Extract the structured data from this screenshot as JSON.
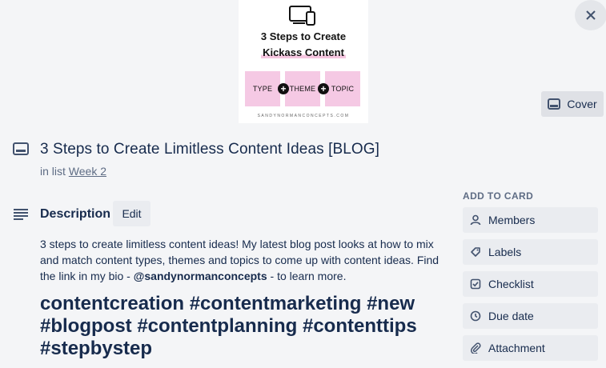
{
  "cover": {
    "title_line1": "3 Steps to Create",
    "title_line2": "Kickass Content",
    "tiles": [
      "TYPE",
      "THEME",
      "TOPIC"
    ],
    "plus": "+",
    "footer": "SANDYNORMANCONCEPTS.COM",
    "cover_button_label": "Cover",
    "close_icon": "close-icon"
  },
  "card": {
    "title": "3 Steps to Create Limitless Content Ideas [BLOG]",
    "in_list_prefix": "in list",
    "list_name": "Week 2"
  },
  "description": {
    "heading": "Description",
    "edit_label": "Edit",
    "text_before": "3 steps to create limitless content ideas! My latest blog post looks at how to mix and match content types, themes and topics to come up with content ideas. Find the link in my bio - ",
    "mention": "@sandynormanconcepts",
    "text_after": " - to learn more.",
    "hashtags": "contentcreation #contentmarketing #new #blogpost #contentplanning #contenttips #stepbystep"
  },
  "sidebar": {
    "heading": "ADD TO CARD",
    "items": [
      {
        "label": "Members",
        "icon": "person-icon"
      },
      {
        "label": "Labels",
        "icon": "tag-icon"
      },
      {
        "label": "Checklist",
        "icon": "checkbox-icon"
      },
      {
        "label": "Due date",
        "icon": "clock-icon"
      },
      {
        "label": "Attachment",
        "icon": "paperclip-icon"
      }
    ]
  }
}
